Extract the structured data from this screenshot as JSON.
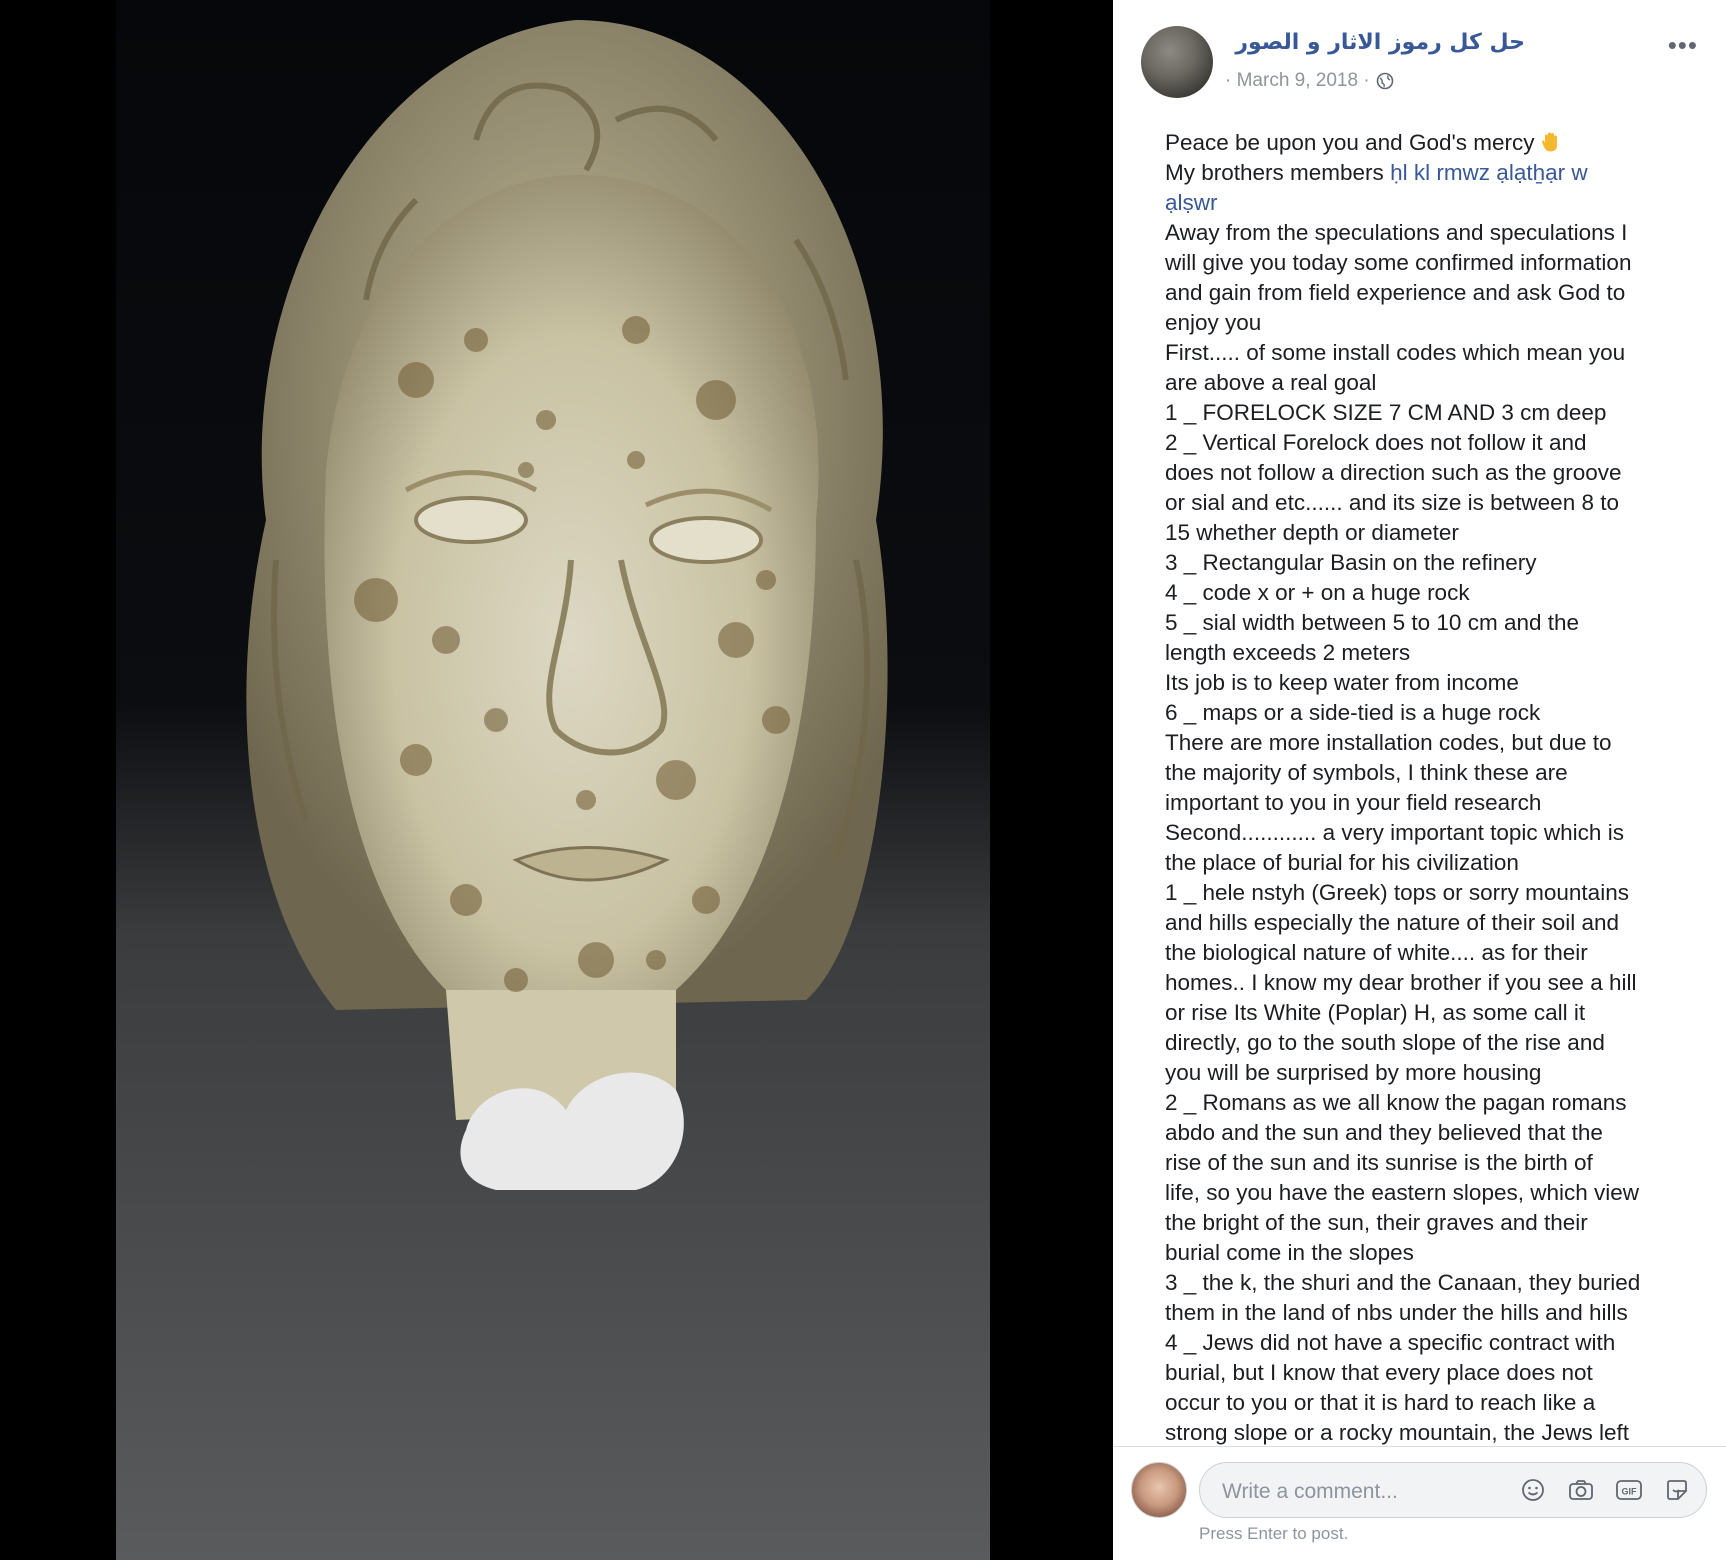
{
  "post": {
    "page_name": "حل كل رموز الاثار و الصور",
    "date": "· March 9, 2018 ·",
    "more_label": "•••",
    "mention_part1": "ḥl kl rmwz ạlạtẖạr w",
    "mention_part2": "ạlṣwr",
    "lines": [
      "Away from the speculations and speculations I",
      "will give you today some confirmed information",
      "and gain from field experience and ask God to",
      "enjoy you",
      "First..... of some install codes which mean you",
      "are above a real goal",
      "1 _ FORELOCK SIZE 7 CM AND 3 cm deep",
      "2 _ Vertical Forelock does not follow it and",
      "does not follow a direction such as the groove",
      "or sial and etc...... and its size is between 8 to",
      "15 whether depth or diameter",
      "3 _ Rectangular Basin on the refinery",
      "4 _ code x or + on a huge rock",
      "5 _ sial width between 5 to 10 cm and the",
      "length exceeds 2 meters",
      "Its job is to keep water from income",
      "6 _ maps or a side-tied is a huge rock",
      "There are more installation codes, but due to",
      "the majority of symbols, I think these are",
      "important to you in your field research",
      "Second............ a very important topic which is",
      "the place of burial for his civilization",
      "1 _ hele nstyh (Greek) tops or sorry mountains",
      "and hills especially the nature of their soil and",
      "the biological nature of white.... as for their",
      "homes.. I know my dear brother if you see a hill",
      "or rise Its White (Poplar) H, as some call it",
      "directly, go to the south slope of the rise and",
      "you will be surprised by more housing",
      "2 _ Romans as we all know the pagan romans",
      "abdo and the sun and they believed that the",
      "rise of the sun and its sunrise is the birth of",
      "life, so you have the eastern slopes, which view",
      "the bright of the sun, their graves and their",
      "burial come in the slopes",
      "3 _ the k, the shuri and the Canaan, they buried",
      "them in the land of nbs under the hills and hills",
      "4 _ Jews did not have a specific contract with",
      "burial, but I know that every place does not",
      "occur to you or that it is hard to reach like a",
      "strong slope or a rocky mountain, the Jews left"
    ],
    "greeting": "Peace be upon you and God's mercy",
    "brothers_prefix": "My brothers members "
  },
  "comment": {
    "placeholder": "Write a comment...",
    "hint": "Press Enter to post."
  },
  "icons": {
    "hand": "raised-hand-icon",
    "globe": "globe-icon",
    "emoji": "emoji-icon",
    "camera": "camera-icon",
    "gif": "gif-icon",
    "sticker": "sticker-icon"
  }
}
